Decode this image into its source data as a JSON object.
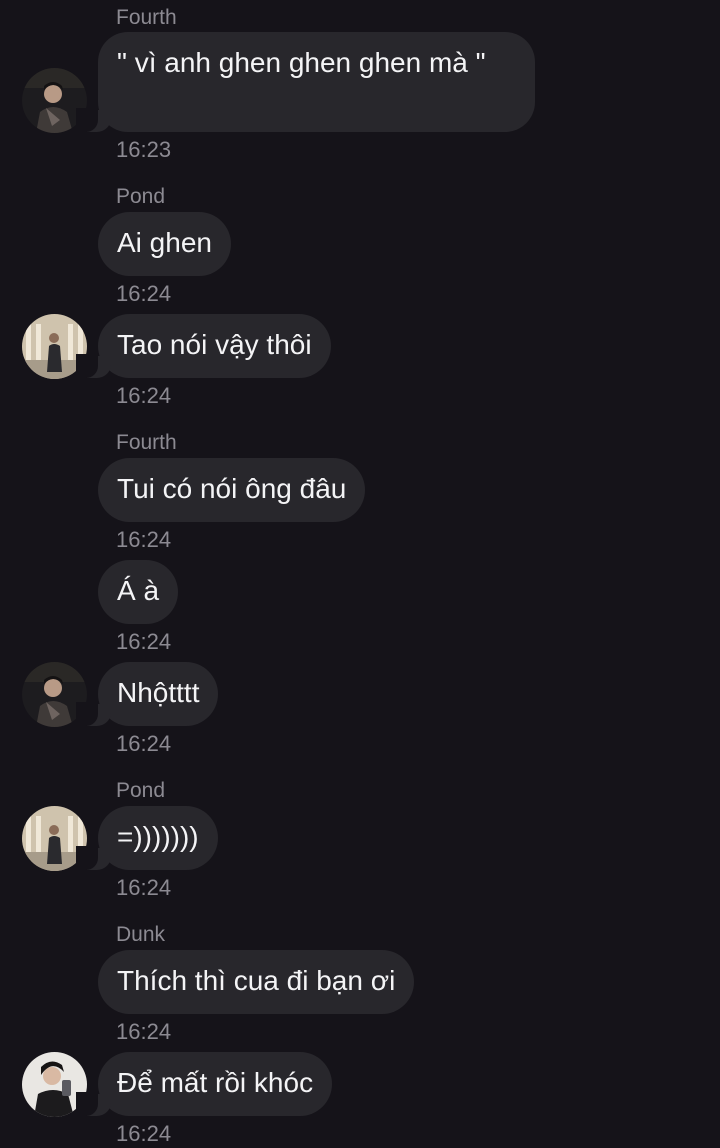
{
  "messages": [
    {
      "sender": "Fourth",
      "text": "\" vì anh ghen ghen ghen mà \"",
      "time": "16:23",
      "avatar": "fourth-avatar"
    },
    {
      "sender": "Pond",
      "text": "Ai ghen",
      "time": "16:24"
    },
    {
      "text": "Tao nói vậy thôi",
      "time": "16:24",
      "avatar": "pond-avatar"
    },
    {
      "sender": "Fourth",
      "text": "Tui có nói ông đâu",
      "time": "16:24"
    },
    {
      "text": "Á à",
      "time": "16:24"
    },
    {
      "text": "Nhộtttt",
      "time": "16:24",
      "avatar": "fourth-avatar"
    },
    {
      "sender": "Pond",
      "text": "=)))))))",
      "time": "16:24",
      "avatar": "pond-avatar"
    },
    {
      "sender": "Dunk",
      "text": "Thích thì cua đi bạn ơi",
      "time": "16:24"
    },
    {
      "text": "Để mất rồi khóc",
      "time": "16:24",
      "avatar": "dunk-avatar"
    }
  ]
}
